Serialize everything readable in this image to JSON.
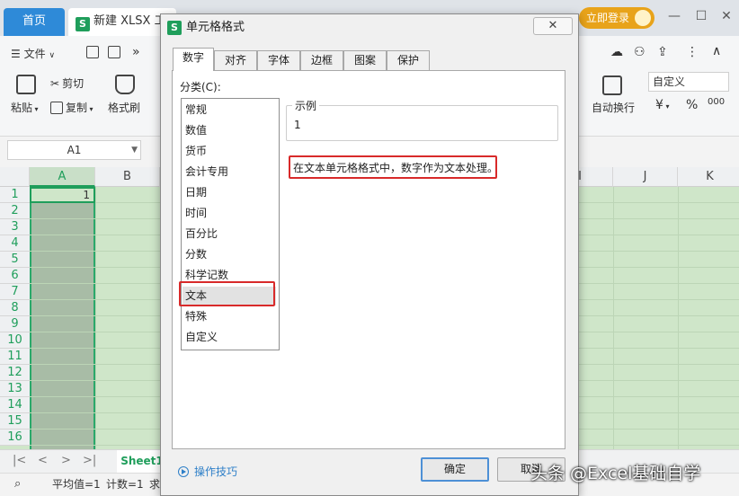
{
  "tabbar": {
    "home_tab": "首页",
    "doc_icon": "S",
    "doc_tab": "新建 XLSX 工作表",
    "login_button": "立即登录",
    "window_controls": [
      "—",
      "☐",
      "✕"
    ]
  },
  "toolbar": {
    "menu_file": "文件",
    "paste": "粘贴",
    "cut": "剪切",
    "copy": "复制",
    "format_painter": "格式刷",
    "wrap_text": "自动换行",
    "number_format": "自定义",
    "currency_symbol": "¥",
    "percent_symbol": "%",
    "thousands_symbol": "000"
  },
  "formula_bar": {
    "name_box": "A1"
  },
  "grid": {
    "columns": [
      "A",
      "B",
      "I",
      "J",
      "K"
    ],
    "rows": [
      "1",
      "2",
      "3",
      "4",
      "5",
      "6",
      "7",
      "8",
      "9",
      "10",
      "11",
      "12",
      "13",
      "14",
      "15",
      "16"
    ],
    "a1_value": "1"
  },
  "sheets": {
    "tabs": [
      "Sheet1"
    ],
    "nav": [
      "|<",
      "<",
      ">",
      ">|"
    ]
  },
  "status": {
    "average": "平均值=1",
    "count": "计数=1",
    "sum_prefix": "求"
  },
  "dialog": {
    "title": "单元格格式",
    "icon": "S",
    "close": "✕",
    "tabs": [
      "数字",
      "对齐",
      "字体",
      "边框",
      "图案",
      "保护"
    ],
    "category_label": "分类(C):",
    "categories": [
      "常规",
      "数值",
      "货币",
      "会计专用",
      "日期",
      "时间",
      "百分比",
      "分数",
      "科学记数",
      "文本",
      "特殊",
      "自定义"
    ],
    "selected_category": "文本",
    "sample_legend": "示例",
    "sample_value": "1",
    "description": "在文本单元格格式中，数字作为文本处理。",
    "tips": "操作技巧",
    "ok": "确定",
    "cancel": "取消",
    "highlight_color": "#d82a2a"
  },
  "watermark": "头条 @Excel基础自学"
}
